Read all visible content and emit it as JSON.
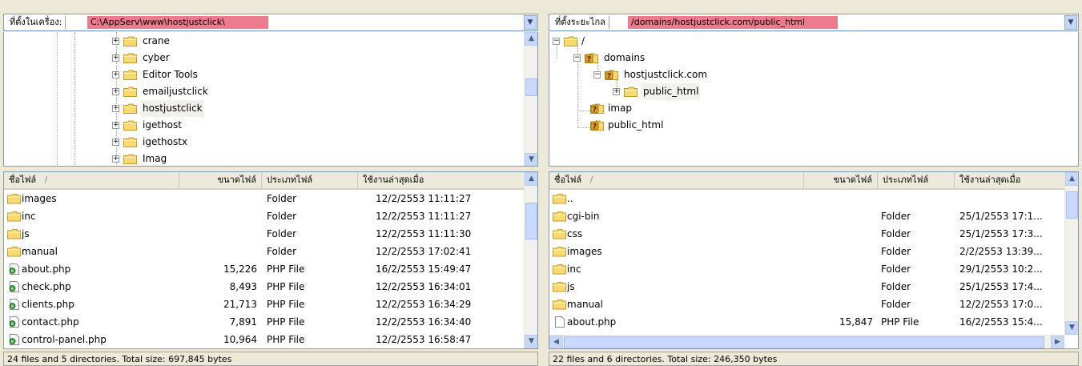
{
  "local": {
    "path_label": "ที่ตั้งในเครื่อง:",
    "path": "C:\\AppServ\\www\\hostjustclick\\",
    "tree": [
      "crane",
      "cyber",
      "Editor Tools",
      "emailjustclick",
      "hostjustclick",
      "igethost",
      "igethostx",
      "Imag"
    ],
    "columns": {
      "name": "ชื่อไฟล์",
      "sort": "/",
      "size": "ขนาดไฟล์",
      "type": "ประเภทไฟล์",
      "modified": "ใช้งานล่าสุดเมื่อ"
    },
    "files": [
      {
        "name": "images",
        "size": "",
        "type": "Folder",
        "modified": "12/2/2553 11:11:27",
        "icon": "folder-icon"
      },
      {
        "name": "inc",
        "size": "",
        "type": "Folder",
        "modified": "12/2/2553 11:11:27",
        "icon": "folder-icon"
      },
      {
        "name": "js",
        "size": "",
        "type": "Folder",
        "modified": "12/2/2553 11:11:30",
        "icon": "folder-icon"
      },
      {
        "name": "manual",
        "size": "",
        "type": "Folder",
        "modified": "12/2/2553 17:02:41",
        "icon": "folder-icon"
      },
      {
        "name": "about.php",
        "size": "15,226",
        "type": "PHP File",
        "modified": "16/2/2553 15:49:47",
        "icon": "php-file-icon"
      },
      {
        "name": "check.php",
        "size": "8,493",
        "type": "PHP File",
        "modified": "12/2/2553 16:34:01",
        "icon": "php-file-icon"
      },
      {
        "name": "clients.php",
        "size": "21,713",
        "type": "PHP File",
        "modified": "12/2/2553 16:34:29",
        "icon": "php-file-icon"
      },
      {
        "name": "contact.php",
        "size": "7,891",
        "type": "PHP File",
        "modified": "12/2/2553 16:34:40",
        "icon": "php-file-icon"
      },
      {
        "name": "control-panel.php",
        "size": "10,964",
        "type": "PHP File",
        "modified": "12/2/2553 16:58:47",
        "icon": "php-file-icon"
      }
    ],
    "status": "24 files and 5 directories. Total size: 697,845 bytes"
  },
  "remote": {
    "path_label": "ที่ตั้งระยะไกล",
    "path": "/domains/hostjustclick.com/public_html",
    "tree": [
      "/",
      "domains",
      "hostjustclick.com",
      "public_html",
      "imap",
      "public_html"
    ],
    "columns": {
      "name": "ชื่อไฟล์",
      "sort": "/",
      "size": "ขนาดไฟล์",
      "type": "ประเภทไฟล์",
      "modified": "ใช้งานล่าสุดเมื่อ"
    },
    "files": [
      {
        "name": "..",
        "size": "",
        "type": "",
        "modified": "",
        "icon": "folder-icon"
      },
      {
        "name": "cgi-bin",
        "size": "",
        "type": "Folder",
        "modified": "25/1/2553 17:1...",
        "icon": "folder-icon"
      },
      {
        "name": "css",
        "size": "",
        "type": "Folder",
        "modified": "25/1/2553 17:3...",
        "icon": "folder-icon"
      },
      {
        "name": "images",
        "size": "",
        "type": "Folder",
        "modified": "2/2/2553 13:39...",
        "icon": "folder-icon"
      },
      {
        "name": "inc",
        "size": "",
        "type": "Folder",
        "modified": "29/1/2553 10:2...",
        "icon": "folder-icon"
      },
      {
        "name": "js",
        "size": "",
        "type": "Folder",
        "modified": "25/1/2553 17:4...",
        "icon": "folder-icon"
      },
      {
        "name": "manual",
        "size": "",
        "type": "Folder",
        "modified": "12/2/2553 17:0...",
        "icon": "folder-icon"
      },
      {
        "name": "about.php",
        "size": "15,847",
        "type": "PHP File",
        "modified": "16/2/2553 15:4...",
        "icon": "file-icon"
      }
    ],
    "status": "22 files and 6 directories. Total size: 246,350 bytes"
  },
  "colors": {
    "path_highlight": "#ec7b8d",
    "window_bg": "#ece9d8",
    "folder": "#f6d365",
    "selection": "#f2f1ec"
  }
}
